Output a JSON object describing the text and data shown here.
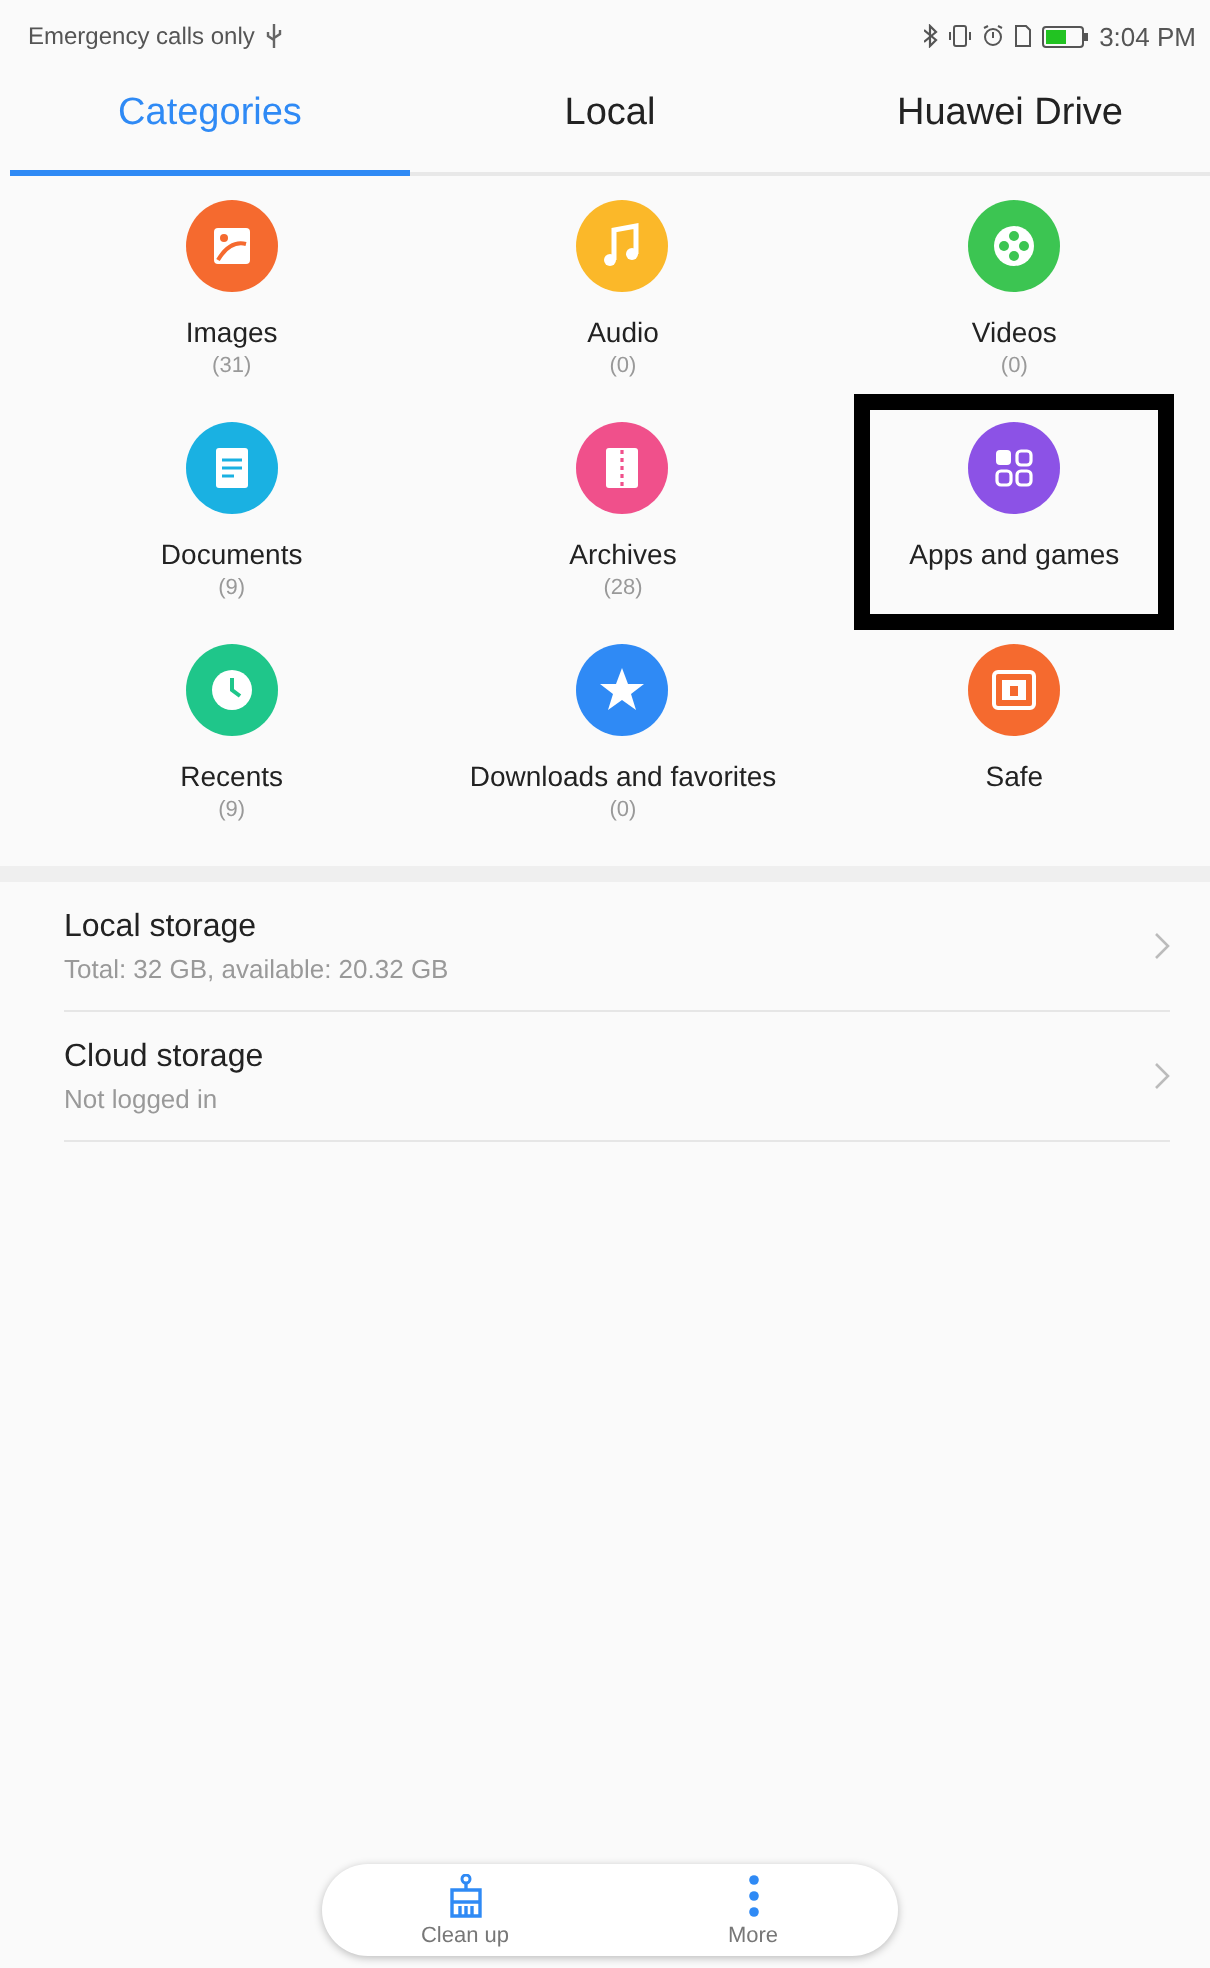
{
  "status_bar": {
    "carrier": "Emergency calls only",
    "time": "3:04 PM"
  },
  "tabs": [
    {
      "label": "Categories",
      "selected": true
    },
    {
      "label": "Local",
      "selected": false
    },
    {
      "label": "Huawei Drive",
      "selected": false
    }
  ],
  "categories": [
    {
      "kind": "images",
      "label": "Images",
      "count": "(31)",
      "color": "#f56a2f",
      "highlighted": false
    },
    {
      "kind": "audio",
      "label": "Audio",
      "count": "(0)",
      "color": "#fbb829",
      "highlighted": false
    },
    {
      "kind": "videos",
      "label": "Videos",
      "count": "(0)",
      "color": "#3cc552",
      "highlighted": false
    },
    {
      "kind": "documents",
      "label": "Documents",
      "count": "(9)",
      "color": "#1ab1e2",
      "highlighted": false
    },
    {
      "kind": "archives",
      "label": "Archives",
      "count": "(28)",
      "color": "#f0508b",
      "highlighted": false
    },
    {
      "kind": "apps",
      "label": "Apps and games",
      "color": "#8c52e6",
      "highlighted": true
    },
    {
      "kind": "recents",
      "label": "Recents",
      "count": "(9)",
      "color": "#1fc68a",
      "highlighted": false
    },
    {
      "kind": "downloads",
      "label": "Downloads and favorites",
      "count": "(0)",
      "color": "#2f8af5",
      "highlighted": false
    },
    {
      "kind": "safe",
      "label": "Safe",
      "color": "#f56a2f",
      "highlighted": false
    }
  ],
  "storage": [
    {
      "title": "Local storage",
      "detail": "Total: 32 GB, available: 20.32 GB"
    },
    {
      "title": "Cloud storage",
      "detail": "Not logged in"
    }
  ],
  "bottom_bar": [
    {
      "kind": "clean",
      "label": "Clean up"
    },
    {
      "kind": "more",
      "label": "More"
    }
  ]
}
